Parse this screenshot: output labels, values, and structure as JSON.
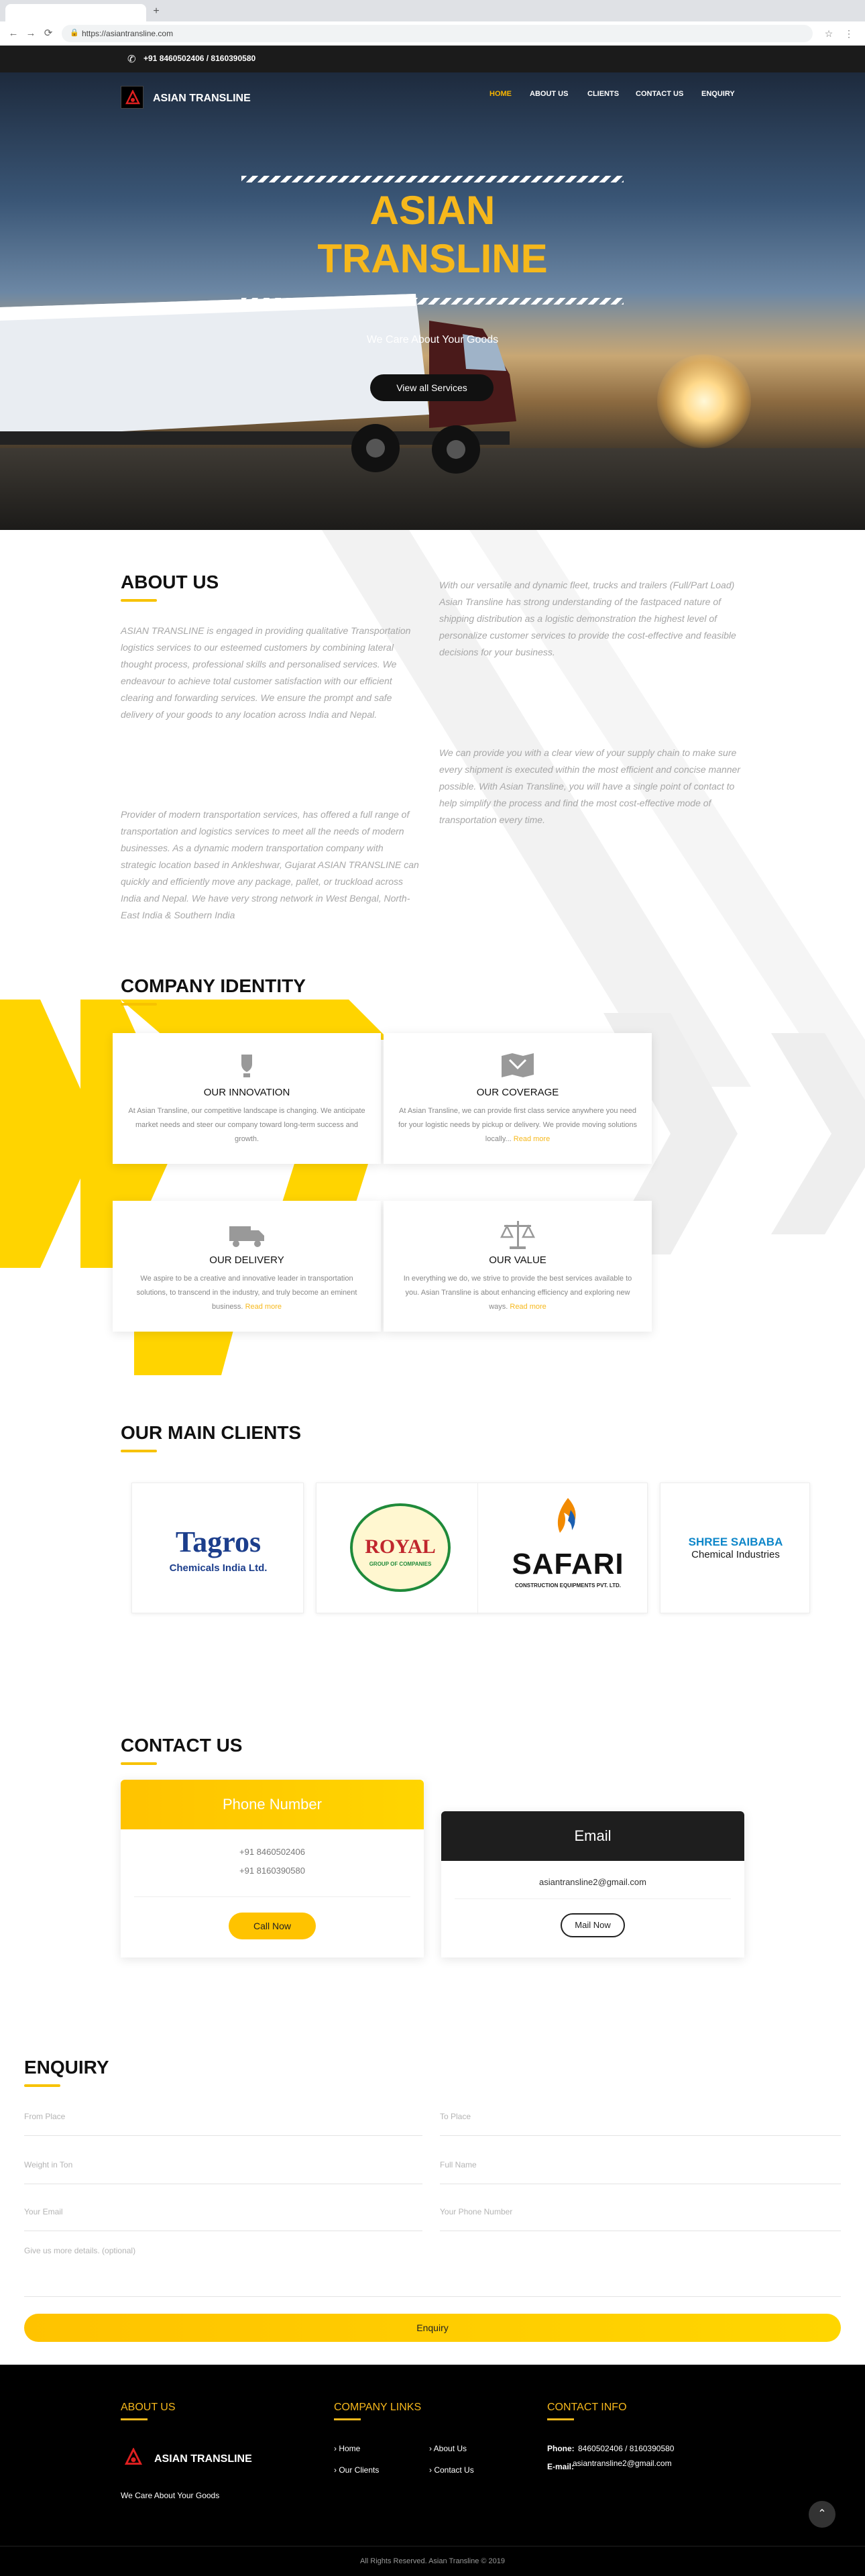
{
  "browser": {
    "url": "https://asiantransline.com"
  },
  "topbar": {
    "phone": "+91 8460502406 / 8160390580"
  },
  "nav": {
    "logo_text": "ASIAN TRANSLINE",
    "items": [
      "HOME",
      "ABOUT US",
      "CLIENTS",
      "CONTACT US",
      "ENQUIRY"
    ],
    "active": "HOME"
  },
  "hero": {
    "title_line1": "ASIAN",
    "title_line2": "TRANSLINE",
    "subtitle": "We Care About Your Goods",
    "button": "View all Services"
  },
  "about": {
    "title": "ABOUT US",
    "left_p1": "ASIAN TRANSLINE is engaged in providing qualitative Transportation logistics services to our esteemed customers by combining lateral thought process, professional skills and personalised services. We endeavour to achieve total customer satisfaction with our efficient clearing and forwarding services. We ensure the prompt and safe delivery of your goods to any location across India and Nepal.",
    "left_p2": "Provider of modern transportation services, has offered a full range of transportation and logistics services to meet all the needs of modern businesses. As a dynamic modern transportation company with strategic location based in Ankleshwar, Gujarat ASIAN TRANSLINE can quickly and efficiently move any package, pallet, or truckload across India and Nepal. We have very strong network in West Bengal, North-East India & Southern India",
    "right_p1": "With our versatile and dynamic fleet, trucks and trailers (Full/Part Load) Asian Transline has strong understanding of the fastpaced nature of shipping distribution as a logistic demonstration the highest level of personalize customer services to provide the cost-effective and feasible decisions for your business.",
    "right_p2": "We can provide you with a clear view of your supply chain to make sure every shipment is executed within the most efficient and concise manner possible. With Asian Transline, you will have a single point of contact to help simplify the process and find the most cost-effective mode of transportation every time."
  },
  "identity": {
    "title": "COMPANY IDENTITY",
    "read_more": "Read more",
    "cards": [
      {
        "title": "OUR INNOVATION",
        "icon": "lightbulb-icon",
        "text": "At Asian Transline, our competitive landscape is changing. We anticipate market needs and steer our company toward long-term success and growth."
      },
      {
        "title": "OUR COVERAGE",
        "icon": "map-icon",
        "text": "At Asian Transline, we can provide first class service anywhere you need for your logistic needs by pickup or delivery. We provide moving solutions locally..."
      },
      {
        "title": "OUR DELIVERY",
        "icon": "truck-icon",
        "text": "We aspire to be a creative and innovative leader in transportation solutions, to transcend in the industry, and truly become an eminent business."
      },
      {
        "title": "OUR VALUE",
        "icon": "scale-icon",
        "text": "In everything we do, we strive to provide the best services available to you. Asian Transline is about enhancing efficiency and exploring new ways."
      }
    ]
  },
  "clients": {
    "title": "OUR MAIN CLIENTS",
    "items": [
      {
        "name": "Tagros",
        "sub": "Chemicals India Ltd."
      },
      {
        "name": "ROYAL",
        "sub": "GROUP OF COMPANIES"
      },
      {
        "name": "SAFARI",
        "sub": "CONSTRUCTION EQUIPMENTS PVT. LTD."
      },
      {
        "name": "SHREE SAIBABA",
        "sub": "Chemical Industries"
      }
    ]
  },
  "contact": {
    "title": "CONTACT US",
    "phone_title": "Phone Number",
    "phone1": "+91 8460502406",
    "phone2": "+91 8160390580",
    "phone_button": "Call Now",
    "email_title": "Email",
    "email": "asiantransline2@gmail.com",
    "email_button": "Mail Now"
  },
  "enquiry": {
    "title": "ENQUIRY",
    "from": "From Place",
    "to": "To Place",
    "weight": "Weight in Ton",
    "full_name": "Full Name",
    "email": "Your Email",
    "phone": "Your Phone Number",
    "details": "Give us more details. (optional)",
    "submit": "Enquiry"
  },
  "footer": {
    "about_title": "ABOUT US",
    "logo_text": "ASIAN TRANSLINE",
    "tagline": "We Care About Your Goods",
    "links_title": "COMPANY LINKS",
    "links": [
      "Home",
      "About Us",
      "Our Clients",
      "Contact Us"
    ],
    "contact_title": "CONTACT INFO",
    "phone_label": "Phone:",
    "phone_value": "8460502406 / 8160390580",
    "email_label": "E-mail:",
    "email_value": "asiantransline2@gmail.com",
    "copyright": "All Rights Reserved. Asian Transline © 2019"
  },
  "colors": {
    "accent": "#f7c200",
    "accent_text": "#f6b81c",
    "dark": "#1b1b1b"
  }
}
